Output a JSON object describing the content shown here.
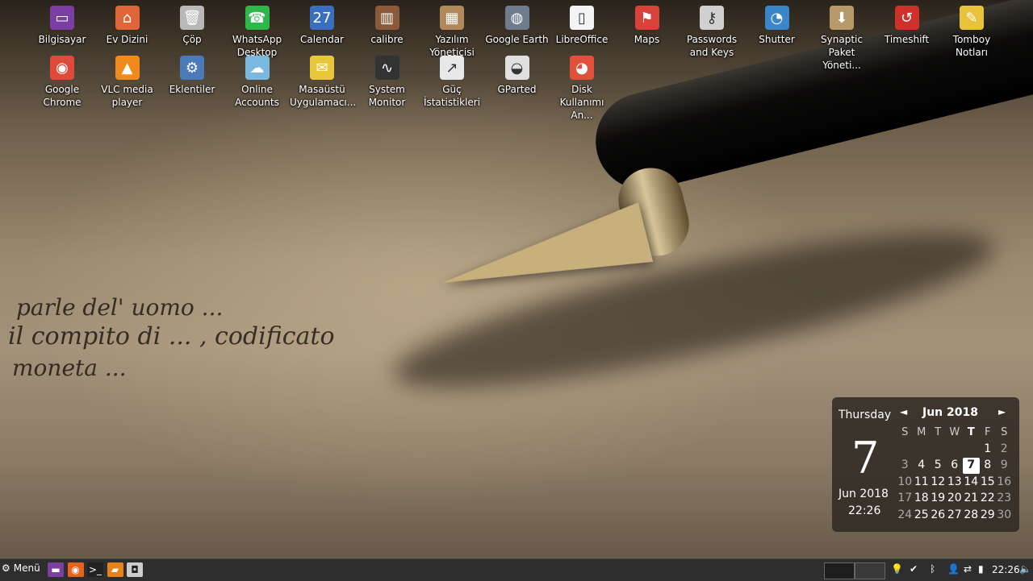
{
  "desktop_icons_row1": [
    {
      "label": "Bilgisayar",
      "icon": "computer-icon",
      "color": "#7b3fa3"
    },
    {
      "label": "Ev Dizini",
      "icon": "home-folder-icon",
      "color": "#e0663a"
    },
    {
      "label": "Çöp",
      "icon": "trash-icon",
      "color": "#b8b8b8"
    },
    {
      "label": "WhatsApp\nDesktop",
      "icon": "whatsapp-icon",
      "color": "#2fb84a"
    },
    {
      "label": "Calendar",
      "icon": "calendar-icon",
      "color": "#3a6fbf"
    },
    {
      "label": "calibre",
      "icon": "calibre-icon",
      "color": "#8a5a3a"
    },
    {
      "label": "Yazılım\nYöneticisi",
      "icon": "software-manager-icon",
      "color": "#b08a5a"
    },
    {
      "label": "Google Earth",
      "icon": "google-earth-icon",
      "color": "#6f7c8c"
    },
    {
      "label": "LibreOffice",
      "icon": "libreoffice-icon",
      "color": "#f4f4f4"
    },
    {
      "label": "Maps",
      "icon": "maps-icon",
      "color": "#d8423a"
    },
    {
      "label": "Passwords\nand Keys",
      "icon": "keys-icon",
      "color": "#d0d0d0"
    },
    {
      "label": "Shutter",
      "icon": "shutter-icon",
      "color": "#3a86c8"
    },
    {
      "label": "Synaptic\nPaket Yöneti...",
      "icon": "synaptic-icon",
      "color": "#b89a6a"
    },
    {
      "label": "Timeshift",
      "icon": "timeshift-icon",
      "color": "#d0302a"
    },
    {
      "label": "Tomboy\nNotları",
      "icon": "tomboy-icon",
      "color": "#e8c23a"
    }
  ],
  "desktop_icons_row2": [
    {
      "label": "Google\nChrome",
      "icon": "chrome-icon",
      "color": "#e04a3a"
    },
    {
      "label": "VLC media\nplayer",
      "icon": "vlc-icon",
      "color": "#f08a1a"
    },
    {
      "label": "Eklentiler",
      "icon": "extensions-icon",
      "color": "#4a7ab8"
    },
    {
      "label": "Online\nAccounts",
      "icon": "cloud-icon",
      "color": "#7ab8e0"
    },
    {
      "label": "Masaüstü\nUygulamacı...",
      "icon": "notes-icon",
      "color": "#e8c83a"
    },
    {
      "label": "System\nMonitor",
      "icon": "system-monitor-icon",
      "color": "#333333"
    },
    {
      "label": "Güç\nİstatistikleri",
      "icon": "power-stats-icon",
      "color": "#e8e8e8"
    },
    {
      "label": "GParted",
      "icon": "gparted-icon",
      "color": "#e0e0e0"
    },
    {
      "label": "Disk\nKullanımı An...",
      "icon": "disk-usage-icon",
      "color": "#e0503a"
    }
  ],
  "calendar": {
    "day_name": "Thursday",
    "day_number": "7",
    "month_year": "Jun 2018",
    "time": "22:26",
    "title": "Jun 2018",
    "prev": "◄",
    "next": "►",
    "headers": [
      "S",
      "M",
      "T",
      "W",
      "T",
      "F",
      "S"
    ],
    "weeks": [
      [
        "",
        "",
        "",
        "",
        "",
        "1",
        "2"
      ],
      [
        "3",
        "4",
        "5",
        "6",
        "7",
        "8",
        "9"
      ],
      [
        "10",
        "11",
        "12",
        "13",
        "14",
        "15",
        "16"
      ],
      [
        "17",
        "18",
        "19",
        "20",
        "21",
        "22",
        "23"
      ],
      [
        "24",
        "25",
        "26",
        "27",
        "28",
        "29",
        "30"
      ]
    ],
    "today": "7"
  },
  "taskbar": {
    "menu_label": "Menü",
    "launchers": [
      {
        "name": "show-desktop-icon",
        "color": "#7b3fa3"
      },
      {
        "name": "firefox-icon",
        "color": "#e8641a"
      },
      {
        "name": "terminal-icon",
        "color": "#222222"
      },
      {
        "name": "files-icon",
        "color": "#e8821a"
      },
      {
        "name": "screenshot-icon",
        "color": "#cccccc"
      }
    ],
    "tray": [
      "lightbulb-icon",
      "shield-icon",
      "bluetooth-icon",
      "user-icon",
      "network-icon",
      "battery-icon"
    ],
    "clock": "22:26",
    "volume": "volume-icon"
  },
  "wallpaper_text": [
    "parle del' uomo ...",
    "il compito di ... , codificato",
    "moneta ..."
  ]
}
